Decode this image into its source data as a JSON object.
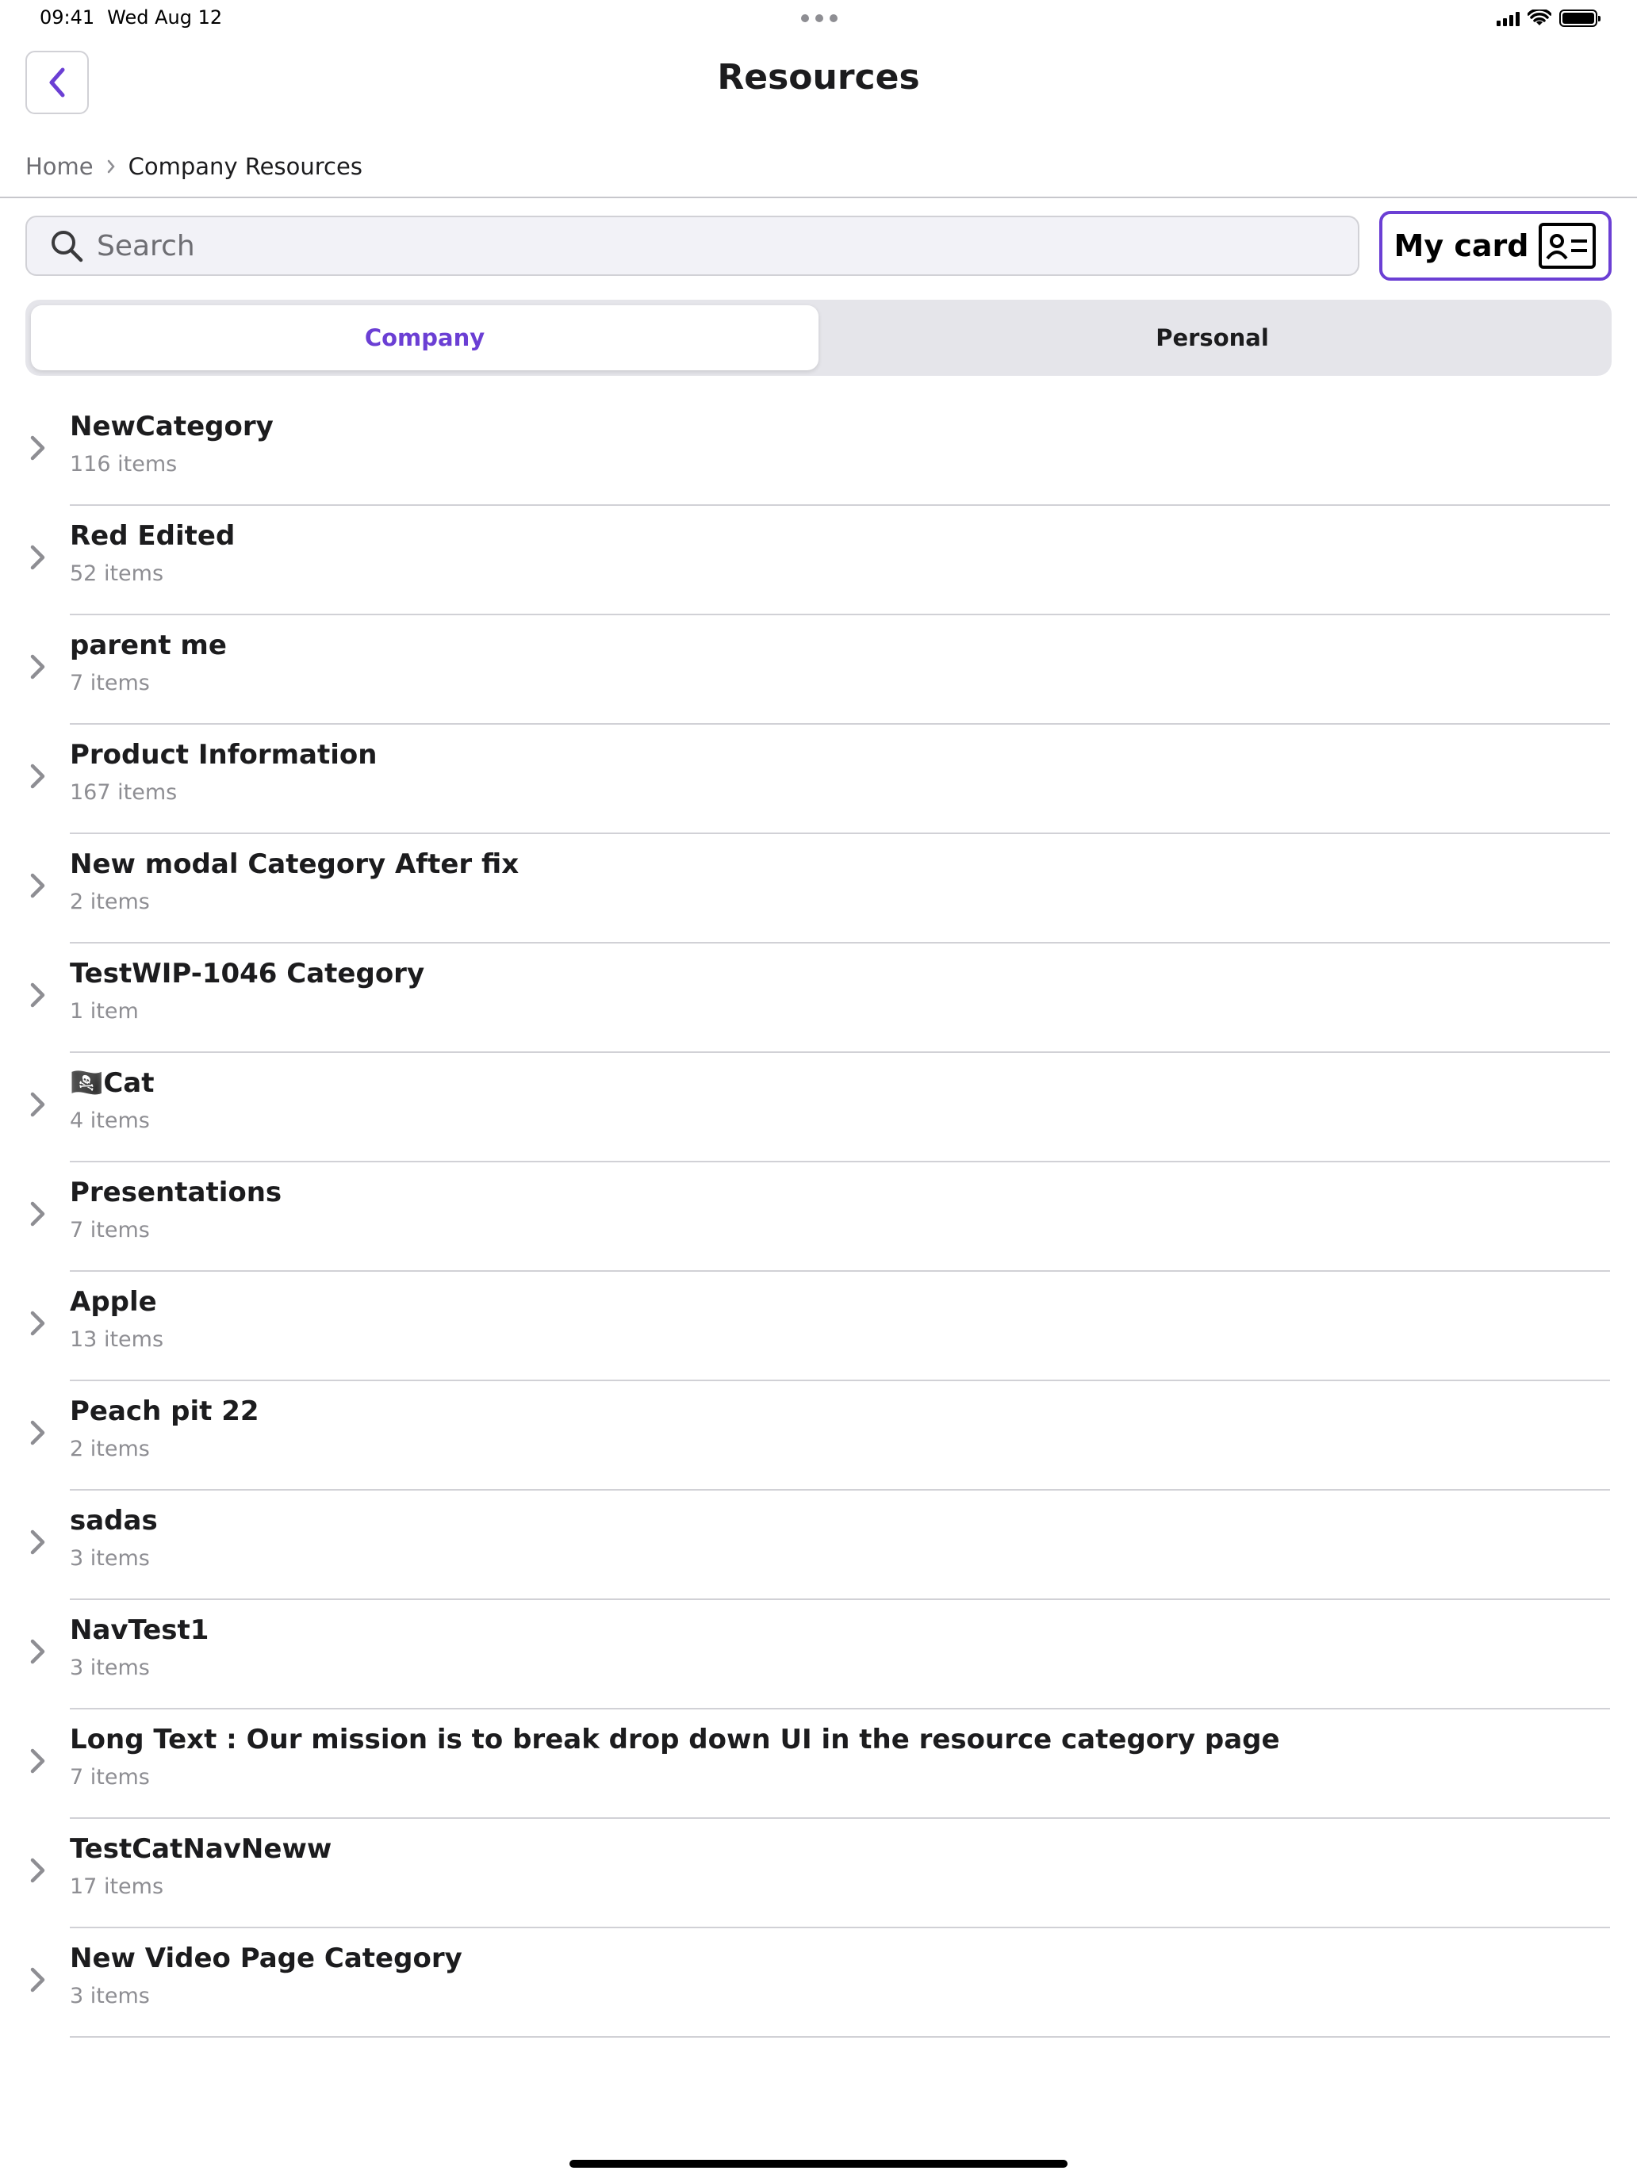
{
  "status_bar": {
    "time": "09:41",
    "date": "Wed Aug 12"
  },
  "nav": {
    "title": "Resources",
    "back_icon": "chevron-left-icon"
  },
  "breadcrumb": {
    "home": "Home",
    "current": "Company Resources"
  },
  "search": {
    "placeholder": "Search",
    "value": ""
  },
  "my_card": {
    "label": "My card",
    "icon": "contact-card-icon"
  },
  "tabs": [
    {
      "label": "Company",
      "selected": true
    },
    {
      "label": "Personal",
      "selected": false
    }
  ],
  "colors": {
    "accent": "#6b3fd4"
  },
  "categories": [
    {
      "title": "NewCategory",
      "count": "116 items"
    },
    {
      "title": "Red Edited",
      "count": "52 items"
    },
    {
      "title": "parent me",
      "count": "7 items"
    },
    {
      "title": "Product Information",
      "count": "167 items"
    },
    {
      "title": "New modal Category After fix",
      "count": "2 items"
    },
    {
      "title": "TestWIP-1046 Category",
      "count": "1 item"
    },
    {
      "title": "🏴‍☠️Cat",
      "count": "4 items"
    },
    {
      "title": "Presentations",
      "count": "7 items"
    },
    {
      "title": "Apple",
      "count": "13 items"
    },
    {
      "title": "Peach pit 22",
      "count": "2 items"
    },
    {
      "title": "sadas",
      "count": "3 items"
    },
    {
      "title": "NavTest1",
      "count": "3 items"
    },
    {
      "title": "Long Text : Our mission is to break drop down UI in the resource category page",
      "count": "7 items"
    },
    {
      "title": "TestCatNavNeww",
      "count": "17 items"
    },
    {
      "title": "New Video Page Category",
      "count": "3 items"
    }
  ]
}
